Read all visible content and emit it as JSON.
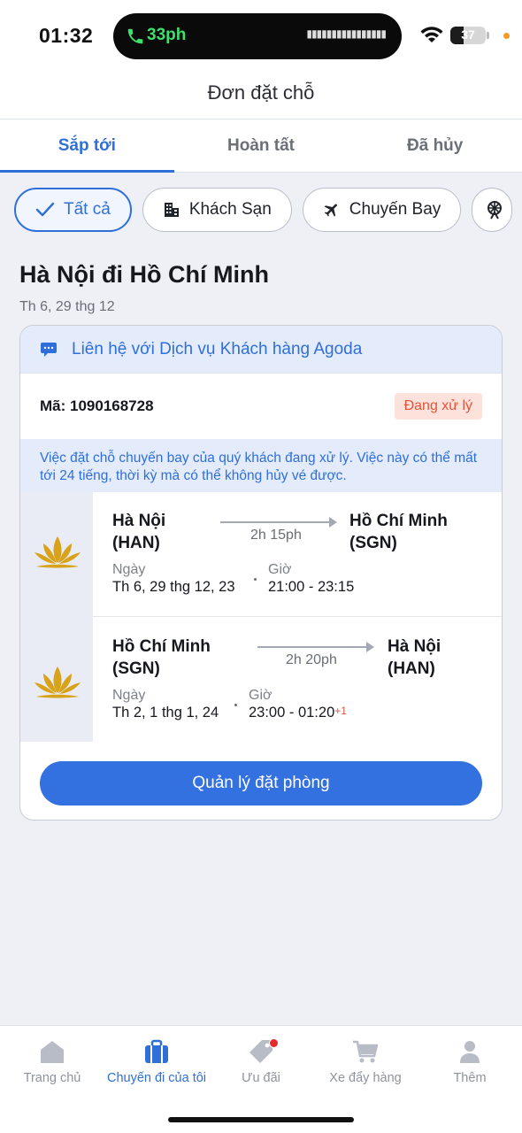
{
  "status_bar": {
    "time": "01:32",
    "call_text": "33ph",
    "battery_percent": 37,
    "battery_text": "37"
  },
  "header": {
    "title": "Đơn đặt chỗ"
  },
  "tabs": [
    {
      "label": "Sắp tới",
      "active": true
    },
    {
      "label": "Hoàn tất",
      "active": false
    },
    {
      "label": "Đã hủy",
      "active": false
    }
  ],
  "filters": [
    {
      "label": "Tất cả",
      "icon": "check-icon",
      "active": true
    },
    {
      "label": "Khách Sạn",
      "icon": "hotel-icon",
      "active": false
    },
    {
      "label": "Chuyến Bay",
      "icon": "plane-icon",
      "active": false
    },
    {
      "label": "",
      "icon": "ferris-wheel-icon",
      "active": false
    }
  ],
  "trip": {
    "title": "Hà Nội đi Hồ Chí Minh",
    "date": "Th 6, 29 thg 12"
  },
  "booking": {
    "contact_text": "Liên hệ với Dịch vụ Khách hàng Agoda",
    "code_text": "Mã: 1090168728",
    "status": "Đang xử lý",
    "notice": "Việc đặt chỗ chuyến bay của quý khách đang xử lý. Việc này có thể mất tới 24 tiếng, thời kỳ mà có thể không hủy vé được.",
    "flights": [
      {
        "from_city": "Hà Nội",
        "from_code": "(HAN)",
        "to_city": "Hồ Chí Minh",
        "to_code": "(SGN)",
        "duration": "2h 15ph",
        "date_label": "Ngày",
        "date": "Th 6, 29 thg 12, 23",
        "time_label": "Giờ",
        "time": "21:00 - 23:15",
        "plus_day": ""
      },
      {
        "from_city": "Hồ Chí Minh",
        "from_code": "(SGN)",
        "to_city": "Hà Nội",
        "to_code": "(HAN)",
        "duration": "2h 20ph",
        "date_label": "Ngày",
        "date": "Th 2, 1 thg 1, 24",
        "time_label": "Giờ",
        "time": "23:00 - 01:20",
        "plus_day": "+1"
      }
    ],
    "manage_label": "Quản lý đặt phòng"
  },
  "bottom_nav": [
    {
      "label": "Trang chủ",
      "icon": "home-icon",
      "active": false
    },
    {
      "label": "Chuyến đi của tôi",
      "icon": "suitcase-icon",
      "active": true
    },
    {
      "label": "Ưu đãi",
      "icon": "tag-icon",
      "active": false,
      "badge": true
    },
    {
      "label": "Xe đẩy hàng",
      "icon": "cart-icon",
      "active": false
    },
    {
      "label": "Thêm",
      "icon": "person-icon",
      "active": false
    }
  ],
  "colors": {
    "accent": "#2f6fd8",
    "button": "#3370e0",
    "status_badge_bg": "#fde2dc",
    "status_badge_text": "#e0533a",
    "lotus_gold": "#d9a21b"
  }
}
